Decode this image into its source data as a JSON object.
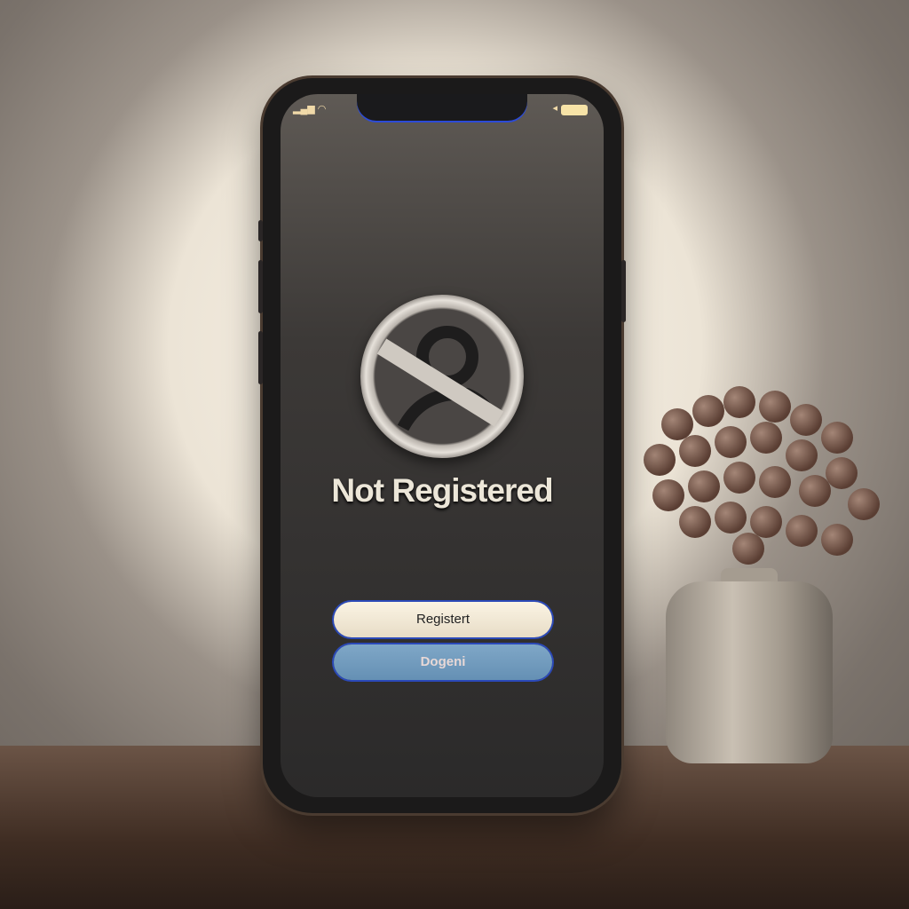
{
  "screen": {
    "title": "Not Registered",
    "status_icon": "not-registered-user-icon",
    "buttons": {
      "register": "Registert",
      "secondary": "Dogeni"
    },
    "status_bar": {
      "signal": "▂▄▆",
      "wifi": "◠",
      "battery_label": "◂"
    }
  },
  "colors": {
    "accent_blue": "#2b49b8",
    "button_light": "#f5ecd9",
    "button_blue": "#739cbf"
  }
}
